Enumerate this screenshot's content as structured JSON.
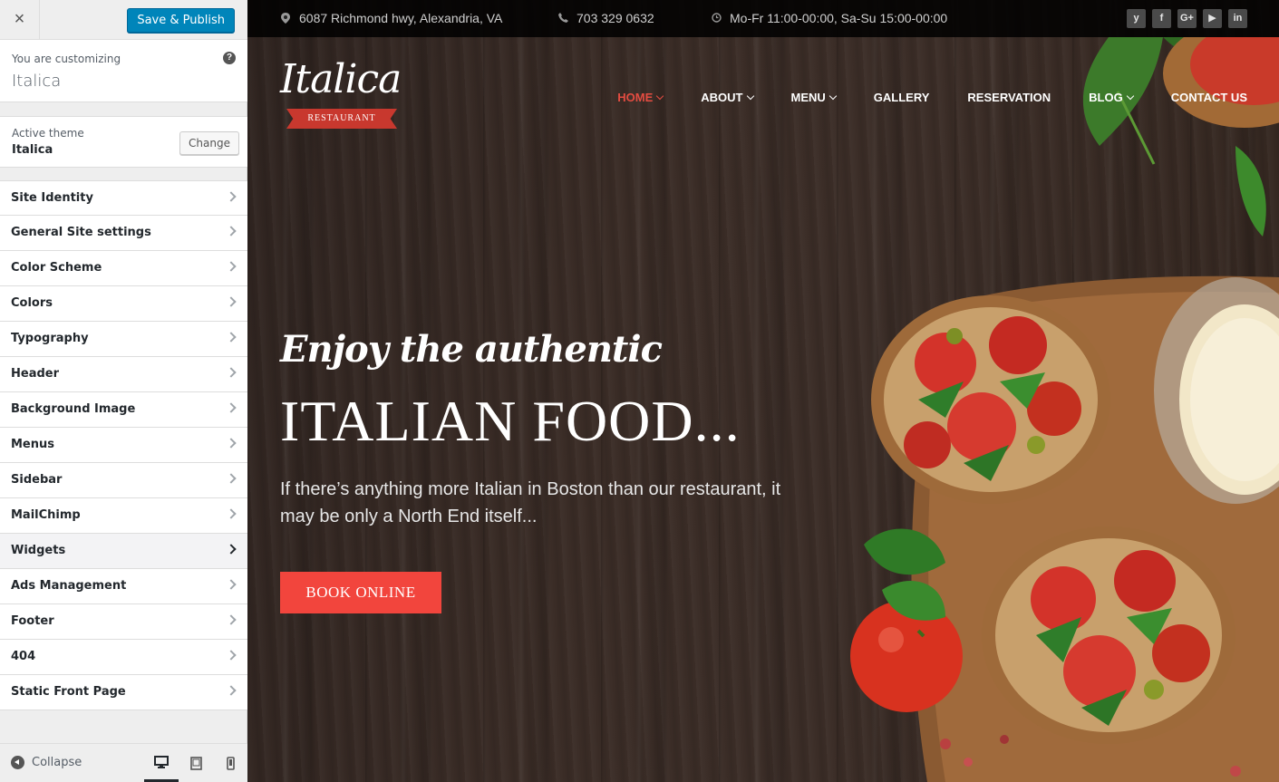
{
  "sidebar": {
    "close_label": "×",
    "save_label": "Save & Publish",
    "info": {
      "subtitle": "You are customizing",
      "title": "Italica",
      "help": "?"
    },
    "theme": {
      "subtitle": "Active theme",
      "name": "Italica",
      "change_label": "Change"
    },
    "items": [
      {
        "label": "Site Identity"
      },
      {
        "label": "General Site settings"
      },
      {
        "label": "Color Scheme"
      },
      {
        "label": "Colors"
      },
      {
        "label": "Typography"
      },
      {
        "label": "Header"
      },
      {
        "label": "Background Image"
      },
      {
        "label": "Menus"
      },
      {
        "label": "Sidebar"
      },
      {
        "label": "MailChimp"
      },
      {
        "label": "Widgets"
      },
      {
        "label": "Ads Management"
      },
      {
        "label": "Footer"
      },
      {
        "label": "404"
      },
      {
        "label": "Static Front Page"
      }
    ],
    "active_item": "Widgets",
    "footer": {
      "collapse_label": "Collapse"
    }
  },
  "preview": {
    "topbar": {
      "address": "6087 Richmond hwy, Alexandria, VA",
      "phone": "703 329 0632",
      "hours": "Mo-Fr 11:00-00:00, Sa-Su 15:00-00:00",
      "socials": [
        "twitter-icon",
        "facebook-icon",
        "google-plus-icon",
        "youtube-icon",
        "linkedin-icon"
      ],
      "social_glyphs": {
        "twitter": "y",
        "facebook": "f",
        "google": "G+",
        "youtube": "▶",
        "linkedin": "in"
      }
    },
    "logo": {
      "text": "Italica",
      "ribbon": "RESTAURANT"
    },
    "nav": [
      {
        "label": "HOME"
      },
      {
        "label": "ABOUT"
      },
      {
        "label": "MENU"
      },
      {
        "label": "GALLERY"
      },
      {
        "label": "RESERVATION"
      },
      {
        "label": "BLOG"
      },
      {
        "label": "CONTACT US"
      }
    ],
    "hero": {
      "script": "Enjoy the authentic",
      "title": "ITALIAN FOOD...",
      "text": "If there’s anything more Italian in Boston than our restaurant, it may be only a North End itself...",
      "button_label": "BOOK ONLINE"
    }
  },
  "colors": {
    "accent": "#f2453d",
    "wp_blue": "#0085ba",
    "nav_active": "#e44c41",
    "ribbon": "#c8382e"
  }
}
